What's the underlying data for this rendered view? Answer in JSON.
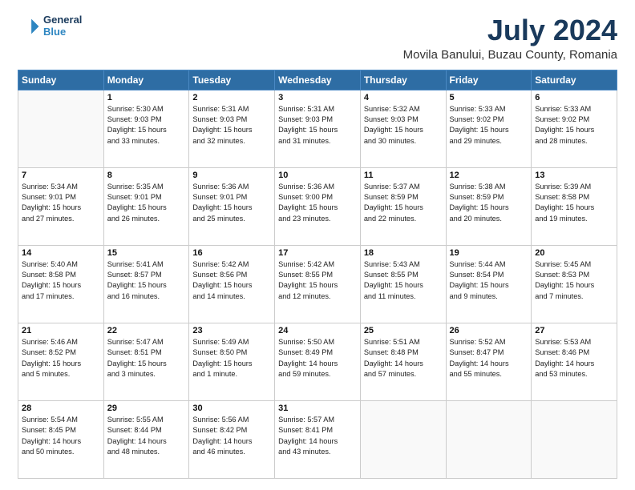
{
  "header": {
    "logo_line1": "General",
    "logo_line2": "Blue",
    "title": "July 2024",
    "subtitle": "Movila Banului, Buzau County, Romania"
  },
  "calendar": {
    "days_of_week": [
      "Sunday",
      "Monday",
      "Tuesday",
      "Wednesday",
      "Thursday",
      "Friday",
      "Saturday"
    ],
    "weeks": [
      [
        {
          "day": "",
          "info": ""
        },
        {
          "day": "1",
          "info": "Sunrise: 5:30 AM\nSunset: 9:03 PM\nDaylight: 15 hours\nand 33 minutes."
        },
        {
          "day": "2",
          "info": "Sunrise: 5:31 AM\nSunset: 9:03 PM\nDaylight: 15 hours\nand 32 minutes."
        },
        {
          "day": "3",
          "info": "Sunrise: 5:31 AM\nSunset: 9:03 PM\nDaylight: 15 hours\nand 31 minutes."
        },
        {
          "day": "4",
          "info": "Sunrise: 5:32 AM\nSunset: 9:03 PM\nDaylight: 15 hours\nand 30 minutes."
        },
        {
          "day": "5",
          "info": "Sunrise: 5:33 AM\nSunset: 9:02 PM\nDaylight: 15 hours\nand 29 minutes."
        },
        {
          "day": "6",
          "info": "Sunrise: 5:33 AM\nSunset: 9:02 PM\nDaylight: 15 hours\nand 28 minutes."
        }
      ],
      [
        {
          "day": "7",
          "info": "Sunrise: 5:34 AM\nSunset: 9:01 PM\nDaylight: 15 hours\nand 27 minutes."
        },
        {
          "day": "8",
          "info": "Sunrise: 5:35 AM\nSunset: 9:01 PM\nDaylight: 15 hours\nand 26 minutes."
        },
        {
          "day": "9",
          "info": "Sunrise: 5:36 AM\nSunset: 9:01 PM\nDaylight: 15 hours\nand 25 minutes."
        },
        {
          "day": "10",
          "info": "Sunrise: 5:36 AM\nSunset: 9:00 PM\nDaylight: 15 hours\nand 23 minutes."
        },
        {
          "day": "11",
          "info": "Sunrise: 5:37 AM\nSunset: 8:59 PM\nDaylight: 15 hours\nand 22 minutes."
        },
        {
          "day": "12",
          "info": "Sunrise: 5:38 AM\nSunset: 8:59 PM\nDaylight: 15 hours\nand 20 minutes."
        },
        {
          "day": "13",
          "info": "Sunrise: 5:39 AM\nSunset: 8:58 PM\nDaylight: 15 hours\nand 19 minutes."
        }
      ],
      [
        {
          "day": "14",
          "info": "Sunrise: 5:40 AM\nSunset: 8:58 PM\nDaylight: 15 hours\nand 17 minutes."
        },
        {
          "day": "15",
          "info": "Sunrise: 5:41 AM\nSunset: 8:57 PM\nDaylight: 15 hours\nand 16 minutes."
        },
        {
          "day": "16",
          "info": "Sunrise: 5:42 AM\nSunset: 8:56 PM\nDaylight: 15 hours\nand 14 minutes."
        },
        {
          "day": "17",
          "info": "Sunrise: 5:42 AM\nSunset: 8:55 PM\nDaylight: 15 hours\nand 12 minutes."
        },
        {
          "day": "18",
          "info": "Sunrise: 5:43 AM\nSunset: 8:55 PM\nDaylight: 15 hours\nand 11 minutes."
        },
        {
          "day": "19",
          "info": "Sunrise: 5:44 AM\nSunset: 8:54 PM\nDaylight: 15 hours\nand 9 minutes."
        },
        {
          "day": "20",
          "info": "Sunrise: 5:45 AM\nSunset: 8:53 PM\nDaylight: 15 hours\nand 7 minutes."
        }
      ],
      [
        {
          "day": "21",
          "info": "Sunrise: 5:46 AM\nSunset: 8:52 PM\nDaylight: 15 hours\nand 5 minutes."
        },
        {
          "day": "22",
          "info": "Sunrise: 5:47 AM\nSunset: 8:51 PM\nDaylight: 15 hours\nand 3 minutes."
        },
        {
          "day": "23",
          "info": "Sunrise: 5:49 AM\nSunset: 8:50 PM\nDaylight: 15 hours\nand 1 minute."
        },
        {
          "day": "24",
          "info": "Sunrise: 5:50 AM\nSunset: 8:49 PM\nDaylight: 14 hours\nand 59 minutes."
        },
        {
          "day": "25",
          "info": "Sunrise: 5:51 AM\nSunset: 8:48 PM\nDaylight: 14 hours\nand 57 minutes."
        },
        {
          "day": "26",
          "info": "Sunrise: 5:52 AM\nSunset: 8:47 PM\nDaylight: 14 hours\nand 55 minutes."
        },
        {
          "day": "27",
          "info": "Sunrise: 5:53 AM\nSunset: 8:46 PM\nDaylight: 14 hours\nand 53 minutes."
        }
      ],
      [
        {
          "day": "28",
          "info": "Sunrise: 5:54 AM\nSunset: 8:45 PM\nDaylight: 14 hours\nand 50 minutes."
        },
        {
          "day": "29",
          "info": "Sunrise: 5:55 AM\nSunset: 8:44 PM\nDaylight: 14 hours\nand 48 minutes."
        },
        {
          "day": "30",
          "info": "Sunrise: 5:56 AM\nSunset: 8:42 PM\nDaylight: 14 hours\nand 46 minutes."
        },
        {
          "day": "31",
          "info": "Sunrise: 5:57 AM\nSunset: 8:41 PM\nDaylight: 14 hours\nand 43 minutes."
        },
        {
          "day": "",
          "info": ""
        },
        {
          "day": "",
          "info": ""
        },
        {
          "day": "",
          "info": ""
        }
      ]
    ]
  }
}
